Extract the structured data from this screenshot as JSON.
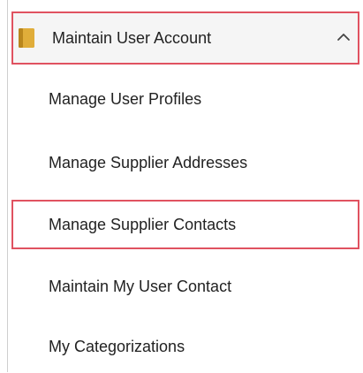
{
  "menu": {
    "header": {
      "label": "Maintain User Account",
      "icon": "folder-icon",
      "expand_icon": "chevron-up-icon",
      "expanded": true
    },
    "items": [
      {
        "label": "Manage User Profiles",
        "highlighted": false
      },
      {
        "label": "Manage Supplier Addresses",
        "highlighted": false
      },
      {
        "label": "Manage Supplier Contacts",
        "highlighted": true
      },
      {
        "label": "Maintain My User Contact",
        "highlighted": false
      },
      {
        "label": "My Categorizations",
        "highlighted": false
      }
    ]
  },
  "colors": {
    "highlight_border": "#e05260",
    "folder_icon": "#d9a52f",
    "header_background": "#f5f5f5",
    "text": "#222222"
  }
}
